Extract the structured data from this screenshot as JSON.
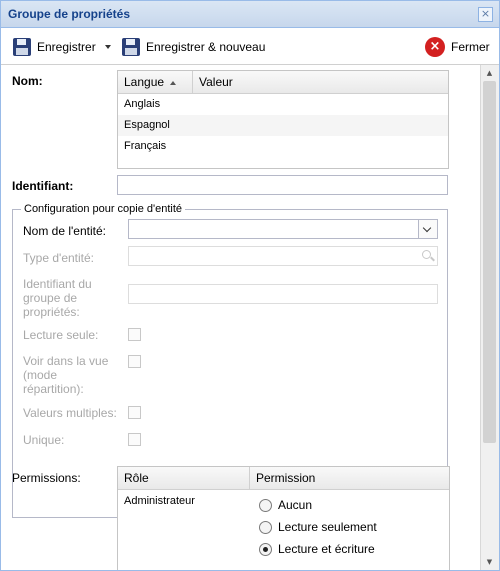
{
  "window": {
    "title": "Groupe de propriétés",
    "close_glyph": "×"
  },
  "toolbar": {
    "save_label": "Enregistrer",
    "save_new_label": "Enregistrer & nouveau",
    "close_label": "Fermer",
    "close_glyph": "×"
  },
  "form": {
    "name_label": "Nom:",
    "name_grid": {
      "columns": [
        "Langue",
        "Valeur"
      ],
      "rows": [
        {
          "language": "Anglais",
          "value": ""
        },
        {
          "language": "Espagnol",
          "value": ""
        },
        {
          "language": "Français",
          "value": ""
        }
      ]
    },
    "identifier_label": "Identifiant:",
    "identifier_value": "",
    "copy_config": {
      "legend": "Configuration pour copie d'entité",
      "entity_name_label": "Nom de l'entité:",
      "entity_name_value": "",
      "entity_type_label": "Type d'entité:",
      "group_id_label": "Identifiant du groupe de propriétés:",
      "readonly_label": "Lecture seule:",
      "view_label": "Voir dans la vue (mode répartition):",
      "multiple_label": "Valeurs multiples:",
      "unique_label": "Unique:"
    },
    "permissions": {
      "label": "Permissions:",
      "columns": [
        "Rôle",
        "Permission"
      ],
      "rows": [
        {
          "role": "Administrateur",
          "options": [
            "Aucun",
            "Lecture seulement",
            "Lecture et écriture"
          ],
          "selected": "Lecture et écriture"
        }
      ]
    }
  },
  "colors": {
    "title": "#15428b",
    "border": "#99bbe8",
    "disabled_text": "#a8a8a8"
  }
}
